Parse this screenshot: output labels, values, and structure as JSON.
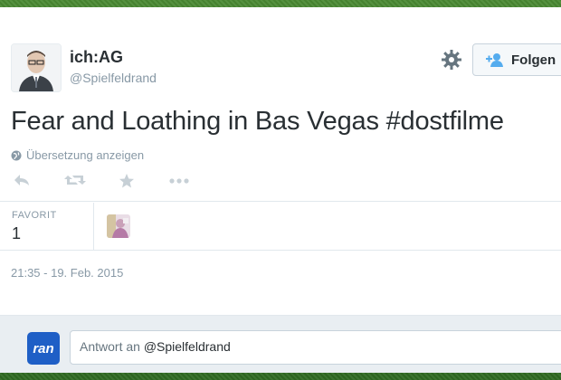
{
  "user": {
    "name": "ich:AG",
    "handle": "@Spielfeldrand"
  },
  "follow_button": {
    "label": "Folgen"
  },
  "tweet": {
    "text": "Fear and Loathing in Bas Vegas #dostfilme",
    "translate_label": "Übersetzung anzeigen",
    "timestamp": "21:35 - 19. Feb. 2015"
  },
  "actions": [
    "reply-icon",
    "retweet-icon",
    "favorite-icon",
    "more-icon"
  ],
  "stats": {
    "favorite_label": "FAVORIT",
    "favorite_count": "1"
  },
  "reply": {
    "logo_text": "ran",
    "prefix": "Antwort an ",
    "mention": "@Spielfeldrand"
  },
  "colors": {
    "text": "#292f33",
    "muted": "#8899a6",
    "accent": "#1f5fc6",
    "background": "#3f7a2c"
  }
}
